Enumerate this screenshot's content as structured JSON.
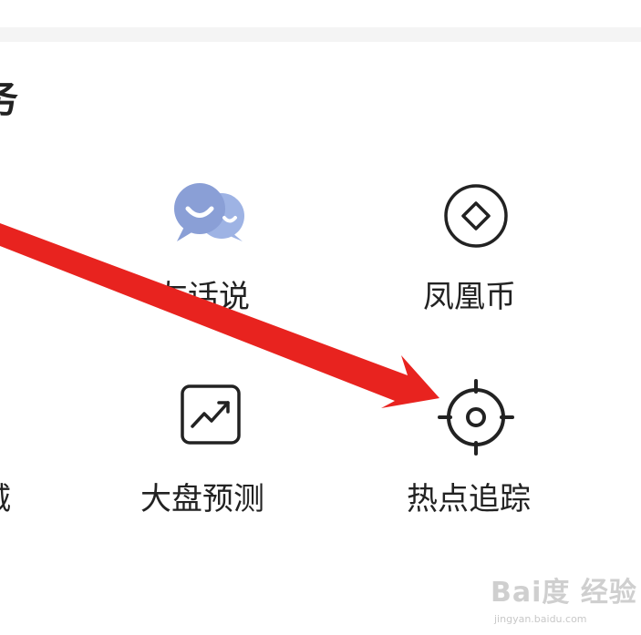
{
  "section": {
    "title": "务"
  },
  "grid": {
    "items": [
      {
        "label": "友话说",
        "icon": "chat-bubbles-icon"
      },
      {
        "label": "凤凰币",
        "icon": "diamond-coin-icon"
      },
      {
        "label": "城",
        "icon": ""
      },
      {
        "label": "大盘预测",
        "icon": "trend-chart-icon"
      },
      {
        "label": "热点追踪",
        "icon": "target-crosshair-icon"
      }
    ]
  },
  "annotation": {
    "arrow_color": "#e8231f"
  },
  "watermark": {
    "main": "Bai度 经验",
    "sub": "jingyan.baidu.com"
  },
  "colors": {
    "chat_icon_primary": "#8a9fd6",
    "chat_icon_secondary": "#9eb3e4",
    "icon_stroke": "#222222",
    "divider": "#f4f4f4"
  }
}
